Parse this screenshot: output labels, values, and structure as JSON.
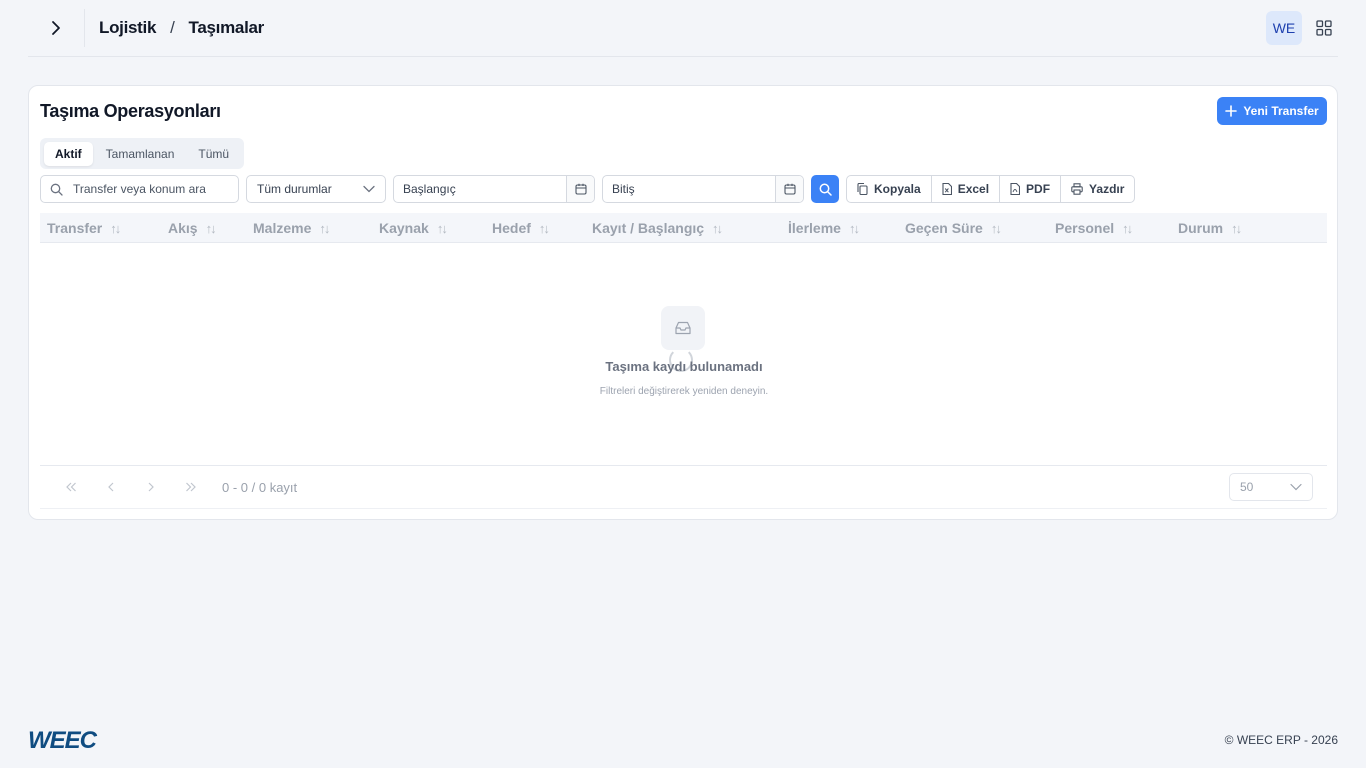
{
  "breadcrumb": {
    "parent": "Lojistik",
    "separator": "/",
    "current": "Taşımalar"
  },
  "user": {
    "initials": "WE"
  },
  "page": {
    "title": "Taşıma Operasyonları",
    "new_button": "Yeni Transfer"
  },
  "tabs": [
    {
      "label": "Aktif"
    },
    {
      "label": "Tamamlanan"
    },
    {
      "label": "Tümü"
    }
  ],
  "filters": {
    "search_placeholder": "Transfer veya konum ara",
    "status_select": "Tüm durumlar",
    "start_placeholder": "Başlangıç",
    "end_placeholder": "Bitiş"
  },
  "export": {
    "copy": "Kopyala",
    "excel": "Excel",
    "pdf": "PDF",
    "print": "Yazdır"
  },
  "table": {
    "columns": [
      "Transfer",
      "Akış",
      "Malzeme",
      "Kaynak",
      "Hedef",
      "Kayıt / Başlangıç",
      "İlerleme",
      "Geçen Süre",
      "Personel",
      "Durum"
    ],
    "sort_glyph": "↑↓"
  },
  "empty": {
    "title": "Taşıma kaydı bulunamadı",
    "subtitle": "Filtreleri değiştirerek yeniden deneyin."
  },
  "pagination": {
    "info": "0 - 0 / 0 kayıt",
    "page_size": "50"
  },
  "footer": {
    "brand": "WEEC",
    "copyright": "© WEEC ERP - 2026"
  },
  "colors": {
    "accent": "#3b82f6",
    "brand": "#0f4c81"
  }
}
